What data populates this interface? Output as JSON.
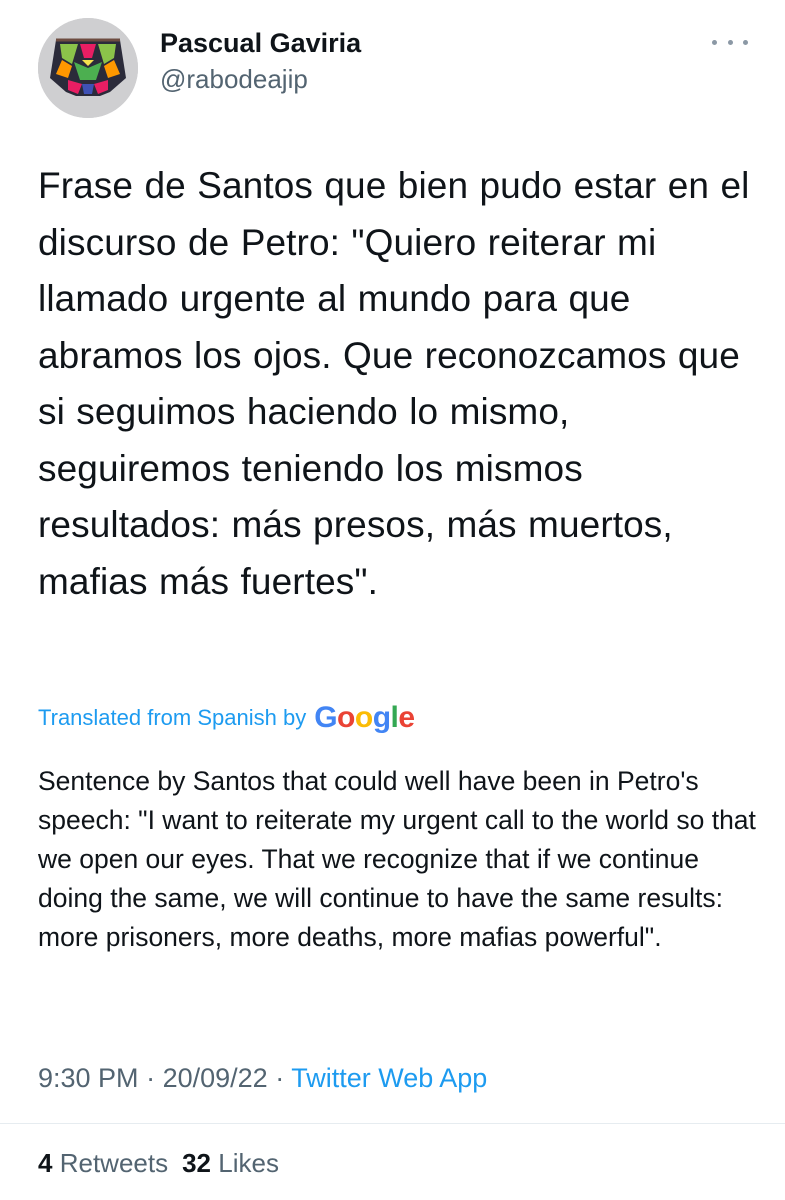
{
  "author": {
    "display_name": "Pascual Gaviria",
    "handle": "@rabodeajip"
  },
  "tweet": {
    "text": "Frase de Santos que bien pudo estar en el discurso de Petro: \"Quiero reiterar mi llamado urgente al mundo para que abramos los ojos. Que reconozcamos que si seguimos haciendo lo mismo, seguiremos teniendo los mismos resultados: más presos, más muertos, mafias más fuertes\".",
    "translated_label": "Translated from Spanish by",
    "translation_provider": "Google",
    "translation": "Sentence by Santos that could well have been in Petro's speech: \"I want to reiterate my urgent call to the world so that we open our eyes. That we recognize that if we continue doing the same, we will continue to have the same results: more prisoners, more deaths, more mafias powerful\"."
  },
  "meta": {
    "time": "9:30 PM",
    "separator": "·",
    "date": "20/09/22",
    "source": "Twitter Web App"
  },
  "stats": {
    "retweets_count": "4",
    "retweets_label": "Retweets",
    "likes_count": "32",
    "likes_label": "Likes"
  },
  "icons": {
    "more": "more-horizontal-icon"
  },
  "colors": {
    "accent": "#1d9bf0",
    "text_primary": "#0f1419",
    "text_secondary": "#536471",
    "divider": "#e6ecf0"
  }
}
